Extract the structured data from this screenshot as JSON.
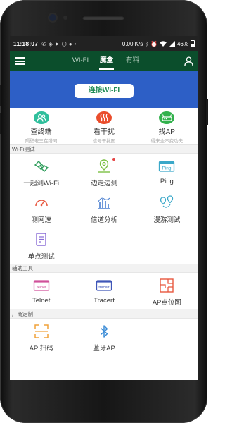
{
  "status_bar": {
    "time": "11:18:07",
    "network_speed": "0.00 K/s",
    "battery": "46%"
  },
  "top_nav": {
    "tabs": [
      {
        "label": "WI-FI",
        "active": false
      },
      {
        "label": "魔盒",
        "active": true
      },
      {
        "label": "有料",
        "active": false
      }
    ],
    "bar_color": "#0b4e2c"
  },
  "banner": {
    "button_label": "连接WI-FI",
    "background_color": "#2d5fc6"
  },
  "quick_actions": [
    {
      "title": "查终端",
      "subtitle": "隔壁老王在蹭网",
      "icon": "user-terminal-icon",
      "color": "#2fbf9c"
    },
    {
      "title": "看干扰",
      "subtitle": "信号干扰图",
      "icon": "interference-waves-icon",
      "color": "#ea4d2c"
    },
    {
      "title": "找AP",
      "subtitle": "得来全不费功夫",
      "icon": "router-icon",
      "color": "#32b14c"
    }
  ],
  "sections": {
    "wifi_test": {
      "title": "Wi-Fi测试",
      "items": [
        {
          "label": "一起测Wi-Fi",
          "icon": "handshake-icon"
        },
        {
          "label": "边走边测",
          "icon": "location-pin-icon",
          "badge": true
        },
        {
          "label": "Ping",
          "icon": "ping-icon"
        },
        {
          "label": "测网速",
          "icon": "speedometer-icon"
        },
        {
          "label": "信道分析",
          "icon": "channel-bars-icon"
        },
        {
          "label": "漫游测试",
          "icon": "roaming-pins-icon"
        },
        {
          "label": "单点测试",
          "icon": "document-edit-icon"
        }
      ]
    },
    "tools": {
      "title": "辅助工具",
      "items": [
        {
          "label": "Telnet",
          "icon": "telnet-icon"
        },
        {
          "label": "Tracert",
          "icon": "tracert-icon"
        },
        {
          "label": "AP点位图",
          "icon": "floor-plan-icon"
        }
      ]
    },
    "vendor": {
      "title": "厂商定制",
      "items": [
        {
          "label": "AP 扫码",
          "icon": "scan-qr-icon"
        },
        {
          "label": "蓝牙AP",
          "icon": "bluetooth-icon"
        }
      ]
    }
  },
  "icon_labels": {
    "ping": "Ping",
    "telnet": "telnet",
    "tracert": "tracert"
  }
}
